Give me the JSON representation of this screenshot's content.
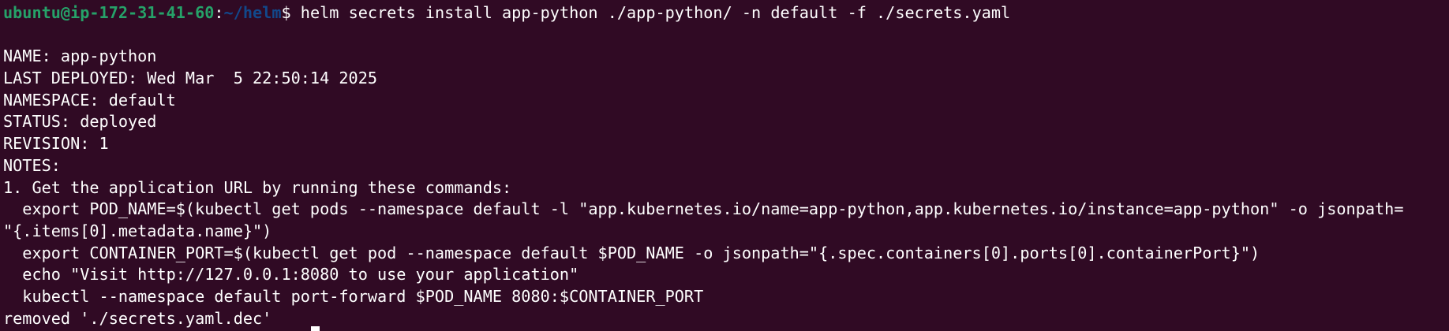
{
  "prompt": {
    "user_host": "ubuntu@ip-172-31-41-60",
    "separator": ":",
    "path": "~/helm",
    "symbol": "$",
    "command": " helm secrets install app-python ./app-python/ -n default -f ./secrets.yaml"
  },
  "output": [
    "",
    "NAME: app-python",
    "LAST DEPLOYED: Wed Mar  5 22:50:14 2025",
    "NAMESPACE: default",
    "STATUS: deployed",
    "REVISION: 1",
    "NOTES:",
    "1. Get the application URL by running these commands:",
    "  export POD_NAME=$(kubectl get pods --namespace default -l \"app.kubernetes.io/name=app-python,app.kubernetes.io/instance=app-python\" -o jsonpath=",
    "\"{.items[0].metadata.name}\")",
    "  export CONTAINER_PORT=$(kubectl get pod --namespace default $POD_NAME -o jsonpath=\"{.spec.containers[0].ports[0].containerPort}\")",
    "  echo \"Visit http://127.0.0.1:8080 to use your application\"",
    "  kubectl --namespace default port-forward $POD_NAME 8080:$CONTAINER_PORT",
    "removed './secrets.yaml.dec'"
  ],
  "colors": {
    "background": "#300a24",
    "user_host": "#26a269",
    "path": "#12488b",
    "text": "#ffffff"
  }
}
